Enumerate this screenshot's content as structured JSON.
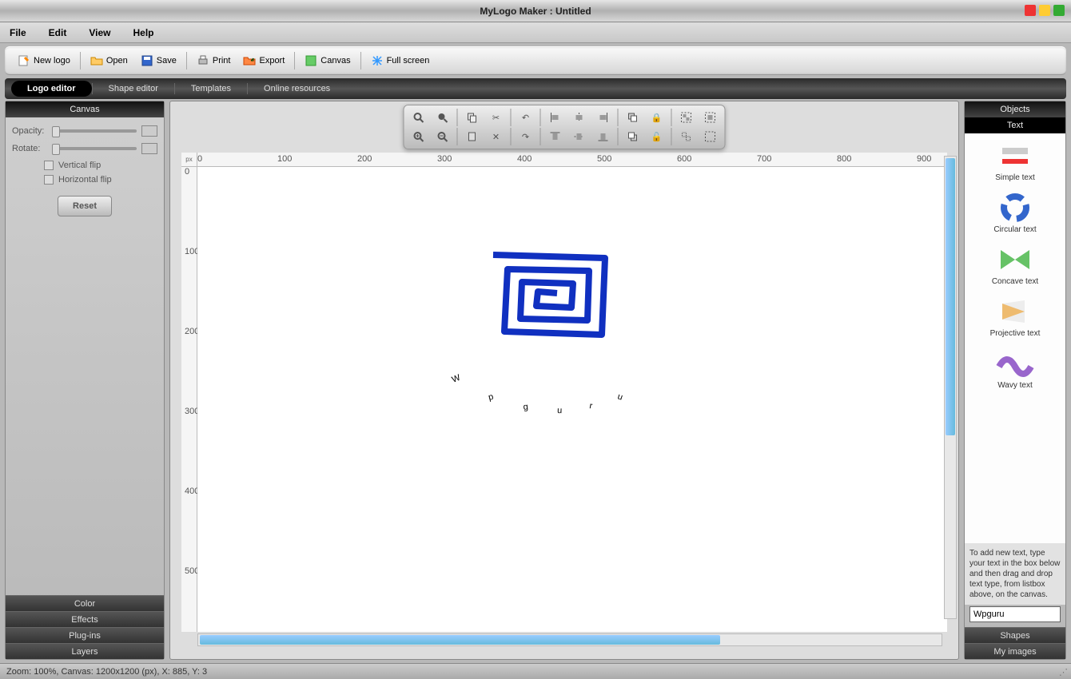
{
  "app": {
    "title": "MyLogo Maker : Untitled"
  },
  "menu": {
    "file": "File",
    "edit": "Edit",
    "view": "View",
    "help": "Help"
  },
  "toolbar": {
    "newlogo": "New logo",
    "open": "Open",
    "save": "Save",
    "print": "Print",
    "export": "Export",
    "canvas": "Canvas",
    "fullscreen": "Full screen"
  },
  "tabs": {
    "logo": "Logo editor",
    "shape": "Shape editor",
    "templates": "Templates",
    "online": "Online resources"
  },
  "left": {
    "header": "Canvas",
    "opacity": "Opacity:",
    "rotate": "Rotate:",
    "vflip": "Vertical flip",
    "hflip": "Horizontal flip",
    "reset": "Reset",
    "acc": {
      "color": "Color",
      "effects": "Effects",
      "plugins": "Plug-ins",
      "layers": "Layers"
    }
  },
  "ruler": {
    "unit": "px",
    "marks_h": [
      "0",
      "100",
      "200",
      "300",
      "400",
      "500",
      "600",
      "700",
      "800",
      "900"
    ],
    "marks_v": [
      "0",
      "100",
      "200",
      "300",
      "400",
      "500"
    ]
  },
  "canvas_art": {
    "text": "Wpguru"
  },
  "right": {
    "objects": "Objects",
    "text": "Text",
    "items": [
      {
        "label": "Simple text"
      },
      {
        "label": "Circular text"
      },
      {
        "label": "Concave text"
      },
      {
        "label": "Projective text"
      },
      {
        "label": "Wavy text"
      }
    ],
    "hint": "To add new text, type your text in the box below and then drag and drop text type, from listbox above, on the canvas.",
    "input_value": "Wpguru",
    "shapes": "Shapes",
    "myimages": "My images"
  },
  "status": "Zoom: 100%, Canvas: 1200x1200 (px), X: 885, Y: 3"
}
